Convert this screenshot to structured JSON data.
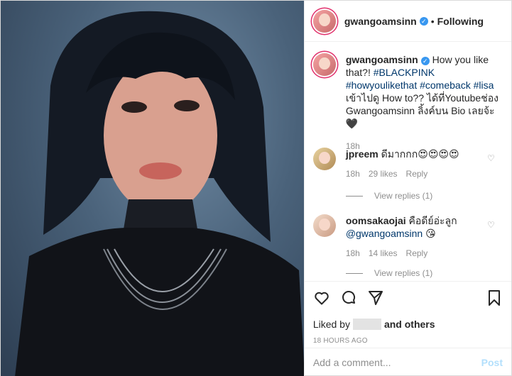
{
  "header": {
    "username": "gwangoamsinn",
    "dot": "•",
    "following": "Following"
  },
  "caption": {
    "username": "gwangoamsinn",
    "text_1": "How you like that?!",
    "tag_1": "#BLACKPINK",
    "tag_2": "#howyoulikethat",
    "tag_3": "#comeback",
    "tag_4": "#lisa",
    "text_2": "เข้าไปดู How to?? ได้ที่Youtubeช่อง Gwangoamsinn ลิ้งค์บน Bio เลยจ้ะ🖤",
    "time": "18h"
  },
  "comments": [
    {
      "username": "jpreem",
      "text": "ดีมากกก😍😍😍😍",
      "time": "18h",
      "likes": "29 likes",
      "reply": "Reply",
      "view_replies": "View replies (1)"
    },
    {
      "username": "oomsakaojai",
      "text": "คือดีย์อ่ะลูก",
      "mention": "@gwangoamsinn",
      "emoji": "😘",
      "time": "18h",
      "likes": "14 likes",
      "reply": "Reply",
      "view_replies": "View replies (1)"
    }
  ],
  "likes": {
    "prefix": "Liked by",
    "suffix": "and others"
  },
  "timestamp": "18 HOURS AGO",
  "add_comment": {
    "placeholder": "Add a comment...",
    "post": "Post"
  },
  "icons": [
    "heart-icon",
    "comment-icon",
    "share-icon",
    "bookmark-icon"
  ],
  "colors": {
    "verified": "#3897f0",
    "link": "#00376b",
    "muted": "#8e8e8e",
    "post_disabled": "#b2dffc"
  }
}
